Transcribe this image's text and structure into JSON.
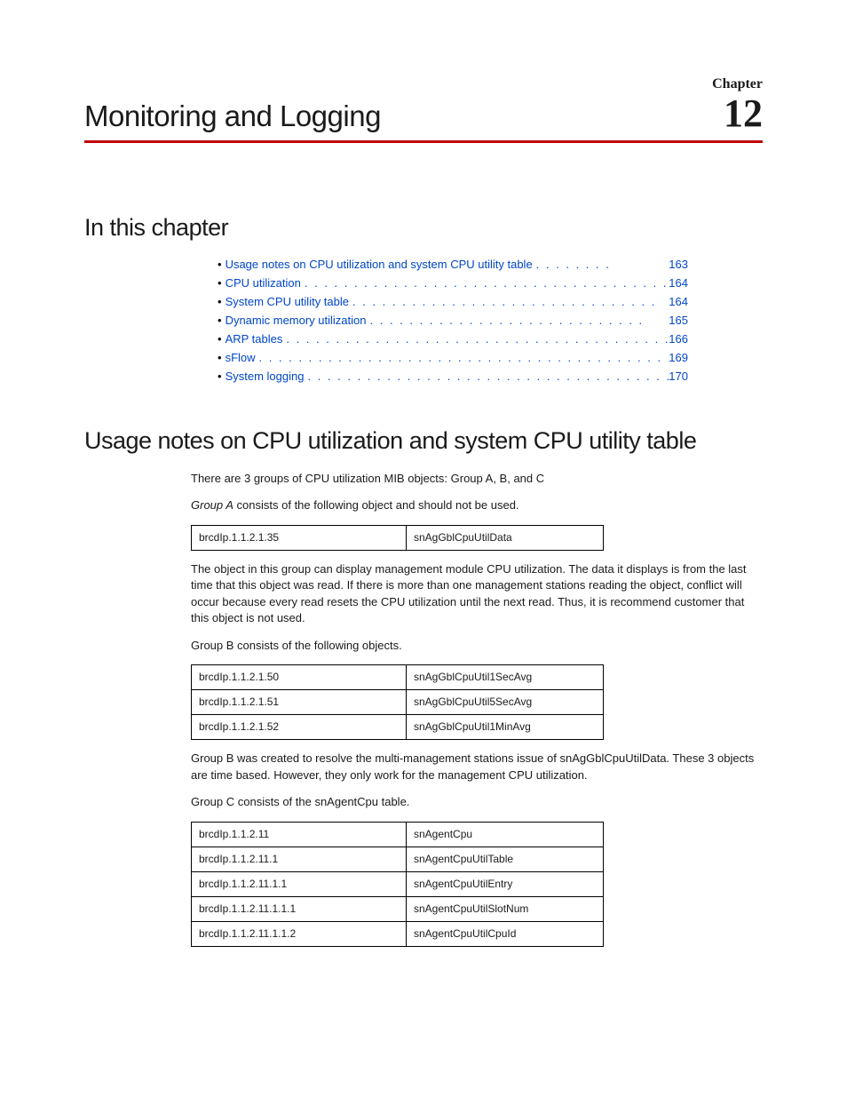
{
  "header": {
    "chapter_label": "Chapter",
    "chapter_number": "12",
    "chapter_title": "Monitoring and Logging"
  },
  "toc": {
    "heading": "In this chapter",
    "items": [
      {
        "label": "Usage notes on CPU utilization and system CPU utility table",
        "page": "163"
      },
      {
        "label": "CPU utilization",
        "page": "164"
      },
      {
        "label": "System CPU utility table",
        "page": "164"
      },
      {
        "label": "Dynamic memory utilization",
        "page": "165"
      },
      {
        "label": "ARP tables",
        "page": "166"
      },
      {
        "label": "sFlow",
        "page": "169"
      },
      {
        "label": "System logging",
        "page": "170"
      }
    ]
  },
  "section": {
    "heading": "Usage notes on CPU utilization and system CPU utility table",
    "para_intro": "There are 3 groups of CPU utilization MIB objects: Group A, B, and C",
    "para_groupA_pre": "Group A",
    "para_groupA_post": " consists of the following object and should not be used.",
    "table_a": [
      {
        "oid": "brcdIp.1.1.2.1.35",
        "name": "snAgGblCpuUtilData"
      }
    ],
    "para_table_a_note": "The object in this group can display management module CPU utilization. The data it displays is from the last time that this object was read. If there is more than one management stations reading the object, conflict will occur because every read resets the CPU utilization until the next read. Thus, it is recommend customer that this object is not used.",
    "para_groupB": "Group B consists of the following objects.",
    "table_b": [
      {
        "oid": "brcdIp.1.1.2.1.50",
        "name": "snAgGblCpuUtil1SecAvg"
      },
      {
        "oid": "brcdIp.1.1.2.1.51",
        "name": "snAgGblCpuUtil5SecAvg"
      },
      {
        "oid": "brcdIp.1.1.2.1.52",
        "name": "snAgGblCpuUtil1MinAvg"
      }
    ],
    "para_groupB_note": "Group B was created to resolve the multi-management stations issue of snAgGblCpuUtilData. These 3 objects are time based. However, they only work for the management CPU utilization.",
    "para_groupC": "Group C consists of the snAgentCpu table.",
    "table_c": [
      {
        "oid": "brcdIp.1.1.2.11",
        "name": "snAgentCpu"
      },
      {
        "oid": "brcdIp.1.1.2.11.1",
        "name": "snAgentCpuUtilTable"
      },
      {
        "oid": "brcdIp.1.1.2.11.1.1",
        "name": "snAgentCpuUtilEntry"
      },
      {
        "oid": "brcdIp.1.1.2.11.1.1.1",
        "name": "snAgentCpuUtilSlotNum"
      },
      {
        "oid": "brcdIp.1.1.2.11.1.1.2",
        "name": "snAgentCpuUtilCpuId"
      }
    ]
  }
}
